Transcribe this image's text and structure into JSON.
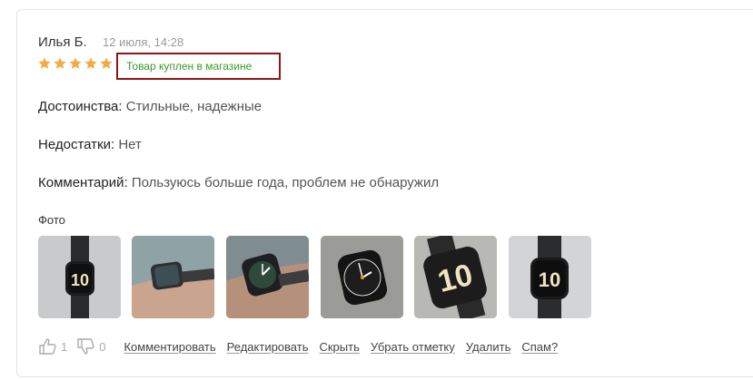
{
  "review": {
    "author": "Илья Б.",
    "date": "12 июля, 14:28",
    "rating": 5,
    "rating_max": 5,
    "badge": "Товар куплен в магазине",
    "pros_label": "Достоинства:",
    "pros_value": "Стильные, надежные",
    "cons_label": "Недостатки:",
    "cons_value": "Нет",
    "comment_label": "Комментарий:",
    "comment_value": "Пользуюсь больше года, проблем не обнаружил",
    "photos_label": "Фото",
    "photos": [
      {
        "icon": "watch-photo-1"
      },
      {
        "icon": "watch-photo-2"
      },
      {
        "icon": "watch-photo-3"
      },
      {
        "icon": "watch-photo-4"
      },
      {
        "icon": "watch-photo-5"
      },
      {
        "icon": "watch-photo-6"
      }
    ]
  },
  "votes": {
    "likes": "1",
    "dislikes": "0"
  },
  "actions": {
    "comment": "Комментировать",
    "edit": "Редактировать",
    "hide": "Скрыть",
    "unmark": "Убрать отметку",
    "delete": "Удалить",
    "spam": "Спам?"
  },
  "colors": {
    "star": "#f5a940",
    "badge_text": "#3b9a2d",
    "badge_border": "#8f1515"
  }
}
